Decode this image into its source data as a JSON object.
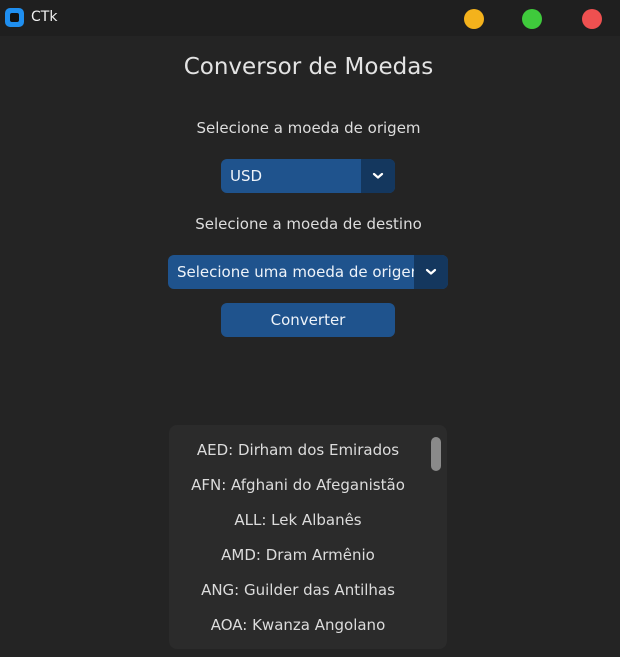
{
  "window": {
    "title": "CTk",
    "app_icon": "ctk-app-icon",
    "controls": [
      "minimize",
      "maximize",
      "close"
    ],
    "colors": {
      "minimize": "#f4b21c",
      "maximize": "#3fca3c",
      "close": "#ee5050"
    }
  },
  "main": {
    "heading": "Conversor de Moedas",
    "origin_label": "Selecione a moeda de origem",
    "origin_value": "USD",
    "dest_label": "Selecione a moeda de destino",
    "dest_value": "Selecione uma moeda de origem",
    "convert_label": "Converter"
  },
  "currency_list": {
    "items": [
      "AED: Dirham dos Emirados",
      "AFN: Afghani do Afeganistão",
      "ALL: Lek Albanês",
      "AMD: Dram Armênio",
      "ANG: Guilder das Antilhas",
      "AOA: Kwanza Angolano"
    ]
  },
  "colors": {
    "accent": "#1f538d",
    "accent_dark": "#14375e",
    "background": "#242424"
  }
}
